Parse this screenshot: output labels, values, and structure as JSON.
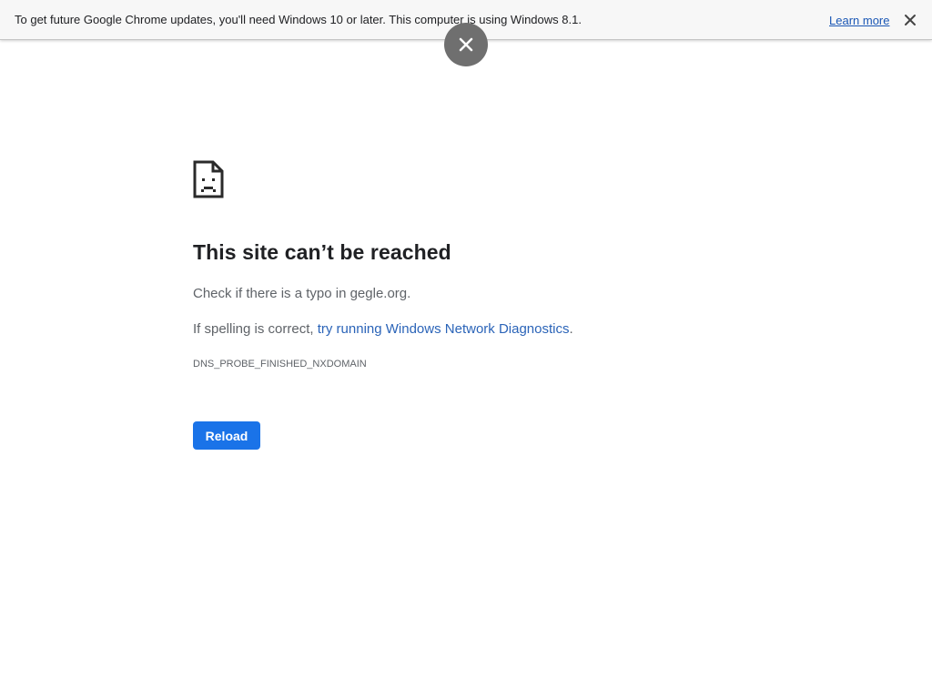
{
  "infobar": {
    "message": "To get future Google Chrome updates, you'll need Windows 10 or later. This computer is using Windows 8.1.",
    "learn_more": "Learn more",
    "close_icon": "close-icon"
  },
  "overlay": {
    "close_icon": "close-icon"
  },
  "error_page": {
    "icon": "sad-page-icon",
    "heading": "This site can’t be reached",
    "line1": "Check if there is a typo in gegle.org.",
    "line2_prefix": "If spelling is correct, ",
    "line2_link": "try running Windows Network Diagnostics",
    "line2_suffix": ".",
    "error_code": "DNS_PROBE_FINISHED_NXDOMAIN",
    "reload_button": "Reload"
  },
  "colors": {
    "link": "#2b64b8",
    "button": "#1a73e8",
    "heading": "#202124",
    "body_text": "#5f6368"
  }
}
